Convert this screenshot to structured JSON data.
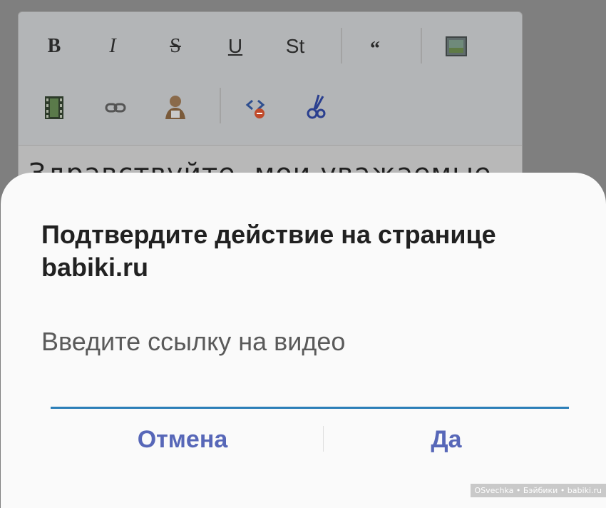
{
  "editor": {
    "toolbar": {
      "bold": "B",
      "italic": "I",
      "strike": "S",
      "underline": "U",
      "style": "St",
      "quote": "“"
    },
    "text": "Здравствуйте, мои уважаемые"
  },
  "dialog": {
    "title": "Подтвердите действие на странице babiki.ru",
    "message": "Введите ссылку на видео",
    "input_value": "",
    "cancel_label": "Отмена",
    "ok_label": "Да",
    "accent_color": "#2c7fb8",
    "button_color": "#5767b8"
  },
  "watermark": "OSvechka • Бэйбики • babiki.ru"
}
